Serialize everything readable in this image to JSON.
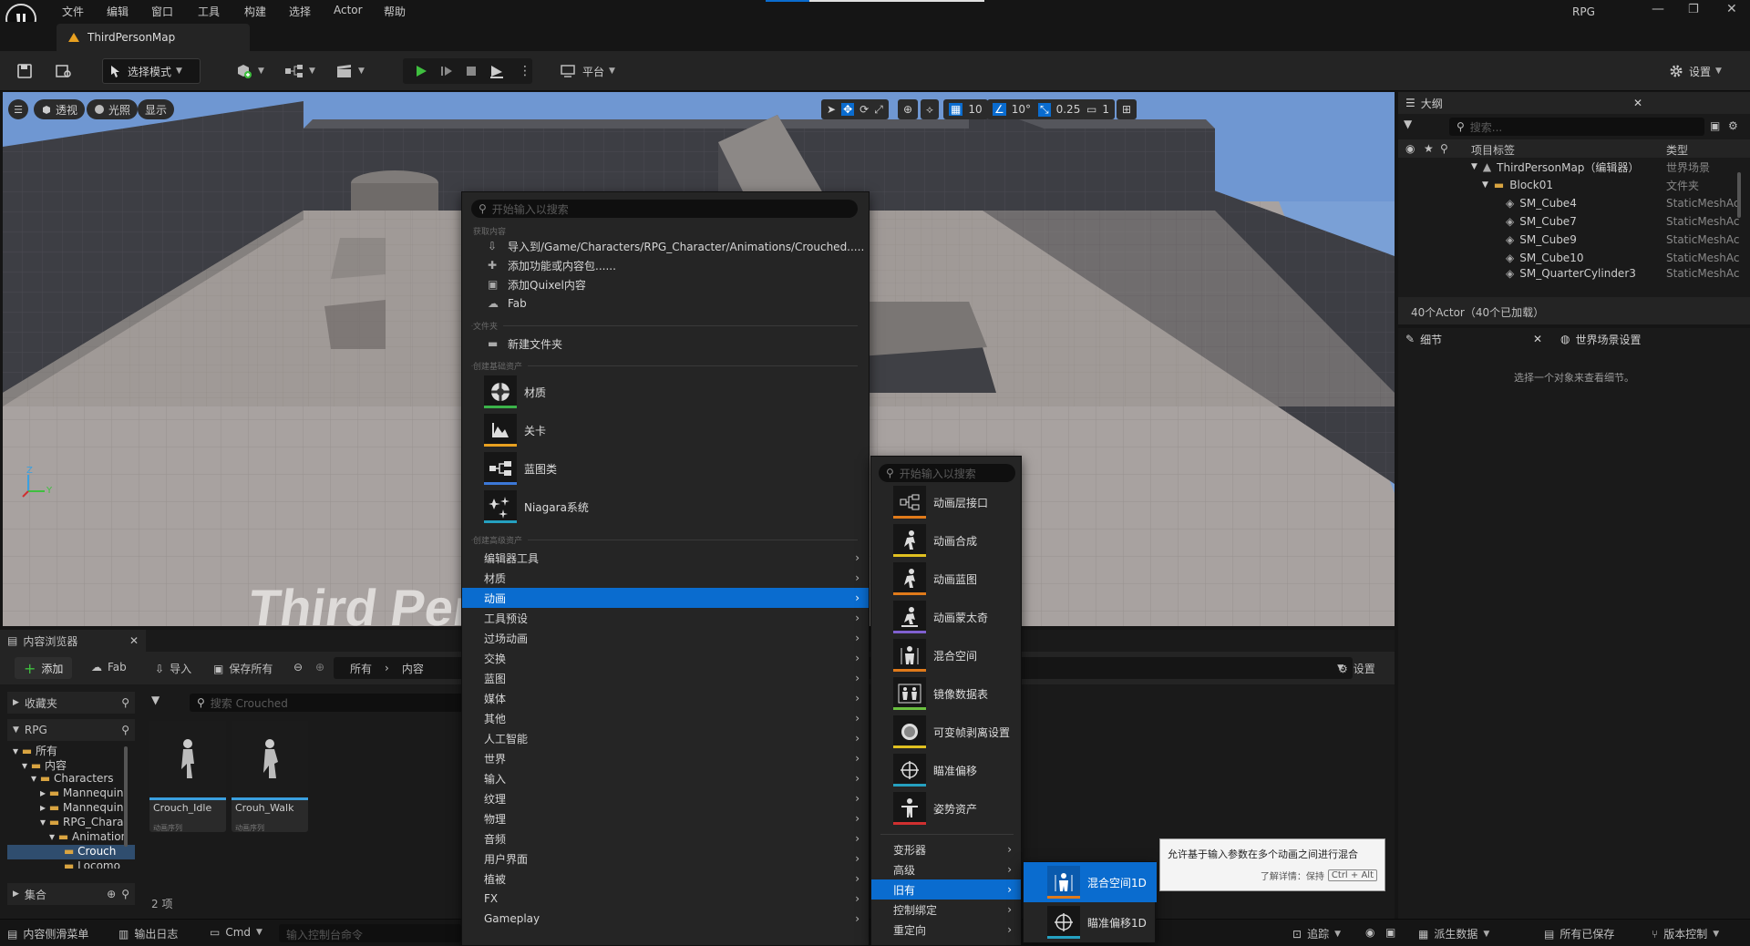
{
  "menubar": {
    "items": [
      "文件",
      "编辑",
      "窗口",
      "工具",
      "构建",
      "选择",
      "Actor",
      "帮助"
    ],
    "project": "RPG"
  },
  "tabbar": {
    "map_tab": "ThirdPersonMap"
  },
  "toolbar": {
    "mode": "选择模式",
    "platform": "平台",
    "settings": "设置"
  },
  "viewport": {
    "perspective": "透视",
    "lighting": "光照",
    "show": "显示",
    "grid_snap": "10",
    "rot_snap": "10°",
    "scale_snap": "0.25",
    "cam_speed": "1",
    "watermark": "Third Person Template",
    "axis_z": "Z",
    "axis_y": "Y"
  },
  "outliner": {
    "title": "大纲",
    "search_placeholder": "搜索...",
    "col_label": "项目标签",
    "col_type": "类型",
    "rows": [
      {
        "name": "ThirdPersonMap（编辑器）",
        "type": "世界场景"
      },
      {
        "name": "Block01",
        "type": "文件夹"
      },
      {
        "name": "SM_Cube4",
        "type": "StaticMeshAc"
      },
      {
        "name": "SM_Cube7",
        "type": "StaticMeshAc"
      },
      {
        "name": "SM_Cube9",
        "type": "StaticMeshAc"
      },
      {
        "name": "SM_Cube10",
        "type": "StaticMeshAc"
      },
      {
        "name": "SM_QuarterCylinder3",
        "type": "StaticMeshAc"
      }
    ],
    "footer": "40个Actor（40个已加载）"
  },
  "details": {
    "tab1": "细节",
    "tab2": "世界场景设置",
    "empty": "选择一个对象来查看细节。"
  },
  "content_browser": {
    "title": "内容浏览器",
    "add": "添加",
    "fab": "Fab",
    "import": "导入",
    "save_all": "保存所有",
    "path": [
      "所有",
      "内容"
    ],
    "settings": "设置",
    "favorites": "收藏夹",
    "project": "RPG",
    "search_placeholder": "搜索 Crouched",
    "tree": [
      "所有",
      "内容",
      "Characters",
      "Mannequin",
      "Mannequin",
      "RPG_Chara",
      "Animation",
      "Crouch",
      "Locomo"
    ],
    "collections": "集合",
    "assets": [
      {
        "name": "Crouch_Idle",
        "type": "动画序列"
      },
      {
        "name": "Crouh_Walk",
        "type": "动画序列"
      }
    ],
    "count": "2 项"
  },
  "statusbar": {
    "drawer": "内容侧滑菜单",
    "output": "输出日志",
    "cmd": "Cmd",
    "console_placeholder": "输入控制台命令",
    "trace": "追踪",
    "derived": "派生数据",
    "saved": "所有已保存",
    "vcs": "版本控制"
  },
  "ctx_main": {
    "search_placeholder": "开始输入以搜索",
    "section_get": "获取内容",
    "import": "导入到/Game/Characters/RPG_Character/Animations/Crouched.....",
    "add_feature": "添加功能或内容包......",
    "add_quixel": "添加Quixel内容",
    "fab": "Fab",
    "section_folder": "文件夹",
    "new_folder": "新建文件夹",
    "section_basic": "创建基础资产",
    "basic": [
      "材质",
      "关卡",
      "蓝图类",
      "Niagara系统"
    ],
    "section_advanced": "创建高级资产",
    "advanced": [
      "编辑器工具",
      "材质",
      "动画",
      "工具预设",
      "过场动画",
      "交换",
      "蓝图",
      "媒体",
      "其他",
      "人工智能",
      "世界",
      "输入",
      "纹理",
      "物理",
      "音频",
      "用户界面",
      "植被",
      "FX",
      "Gameplay"
    ]
  },
  "ctx_anim": {
    "search_placeholder": "开始输入以搜索",
    "items": [
      "动画层接口",
      "动画合成",
      "动画蓝图",
      "动画蒙太奇",
      "混合空间",
      "镜像数据表",
      "可变帧剥离设置",
      "瞄准偏移",
      "姿势资产"
    ],
    "subs": [
      "变形器",
      "高级",
      "旧有",
      "控制绑定",
      "重定向"
    ]
  },
  "ctx_legacy": {
    "items": [
      "混合空间1D",
      "瞄准偏移1D"
    ]
  },
  "tooltip": {
    "text": "允许基于输入参数在多个动画之间进行混合",
    "more": "了解详情：保持",
    "key": "Ctrl + Alt"
  },
  "colors": {
    "accent": "#0a6ccf",
    "green": "#3fbf3f",
    "material": "#3bb34a",
    "level": "#e8a020",
    "blueprint": "#3c78d8",
    "anim_orange": "#e07a1a",
    "anim_green": "#6abf3f",
    "anim_purple": "#8060d0",
    "anim_red": "#d03030",
    "anim_teal": "#25a0c0"
  }
}
